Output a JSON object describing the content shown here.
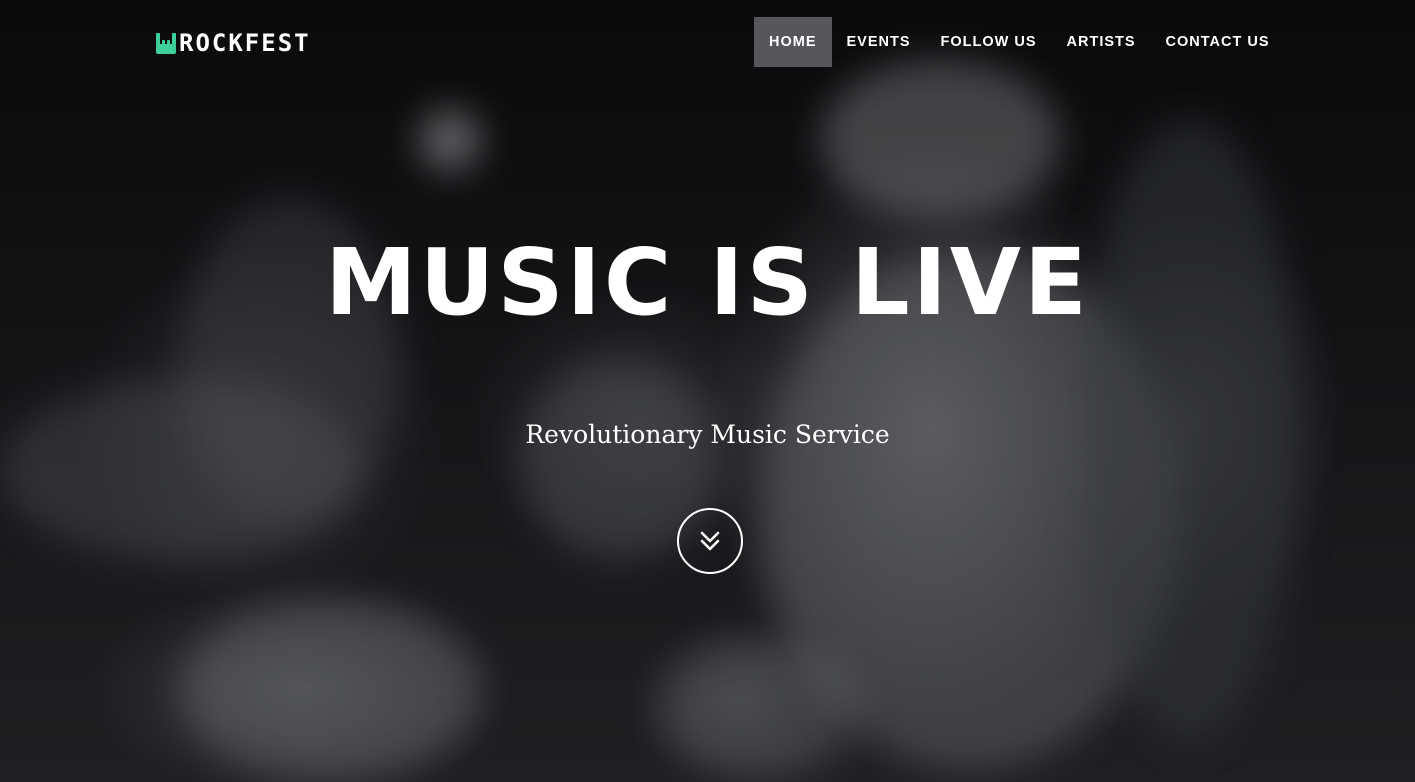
{
  "brand": {
    "logo_text": "ROCKFEST",
    "logo_icon": "rock-hand-icon",
    "accent_color": "#3ecf9b"
  },
  "nav": {
    "items": [
      {
        "label": "HOME",
        "active": true
      },
      {
        "label": "EVENTS",
        "active": false
      },
      {
        "label": "FOLLOW US",
        "active": false
      },
      {
        "label": "ARTISTS",
        "active": false
      },
      {
        "label": "CONTACT US",
        "active": false
      }
    ]
  },
  "hero": {
    "headline": "MUSIC IS LIVE",
    "subheadline": "Revolutionary Music Service",
    "scroll_icon": "double-chevron-down-icon"
  }
}
